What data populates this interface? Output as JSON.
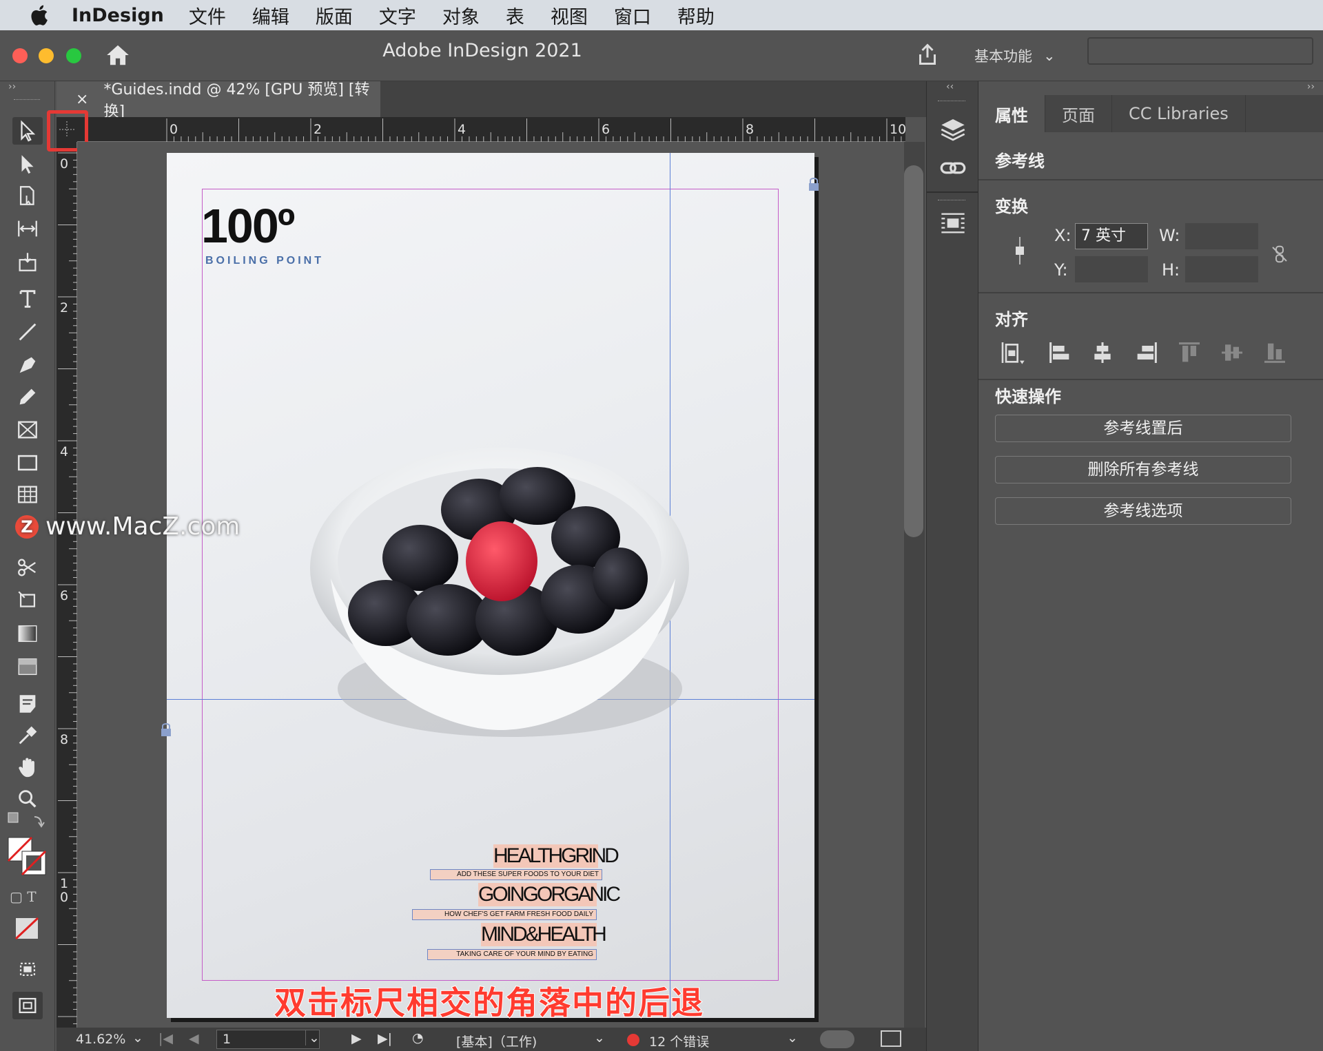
{
  "menubar": {
    "app_name": "InDesign",
    "items": [
      "文件",
      "编辑",
      "版面",
      "文字",
      "对象",
      "表",
      "视图",
      "窗口",
      "帮助"
    ]
  },
  "window": {
    "title": "Adobe InDesign 2021",
    "workspace": "基本功能",
    "search_placeholder": ""
  },
  "document_tab": {
    "close": "×",
    "label": "*Guides.indd @ 42% [GPU 预览] [转换]"
  },
  "rulers": {
    "horizontal_ticks": [
      "0",
      "2",
      "4",
      "6",
      "8",
      "10"
    ],
    "vertical_ticks": [
      "0",
      "2",
      "4",
      "6",
      "8",
      "1\n0"
    ]
  },
  "page_content": {
    "logo_title": "100º",
    "logo_subtitle": "BOILING POINT",
    "headlines": [
      {
        "title": "HEALTHGRIND",
        "subtitle": "ADD THESE SUPER FOODS TO YOUR DIET"
      },
      {
        "title": "GOINGORGANIC",
        "subtitle": "HOW CHEF'S GET FARM FRESH FOOD DAILY"
      },
      {
        "title": "MIND&HEALTH",
        "subtitle": "TAKING CARE OF YOUR MIND BY EATING"
      }
    ]
  },
  "overlay": {
    "watermark": "www.MacZ.com",
    "caption": "双击标尺相交的角落中的后退"
  },
  "statusbar": {
    "zoom": "41.62%",
    "page": "1",
    "style": "[基本]（工作)",
    "errors": "12 个错误"
  },
  "panel": {
    "tabs": [
      "属性",
      "页面",
      "CC Libraries"
    ],
    "guides_heading": "参考线",
    "transform_heading": "变换",
    "x_label": "X:",
    "x_value": "7 英寸",
    "y_label": "Y:",
    "y_value": "",
    "w_label": "W:",
    "w_value": "",
    "h_label": "H:",
    "h_value": "",
    "align_heading": "对齐",
    "quick_heading": "快速操作",
    "buttons": [
      "参考线置后",
      "删除所有参考线",
      "参考线选项"
    ]
  },
  "colors": {
    "accent_highlight": "#e53935",
    "guide_blue": "#5b7fd6",
    "margin_magenta": "#c45bc7",
    "caption_red": "#ff3b2f"
  }
}
